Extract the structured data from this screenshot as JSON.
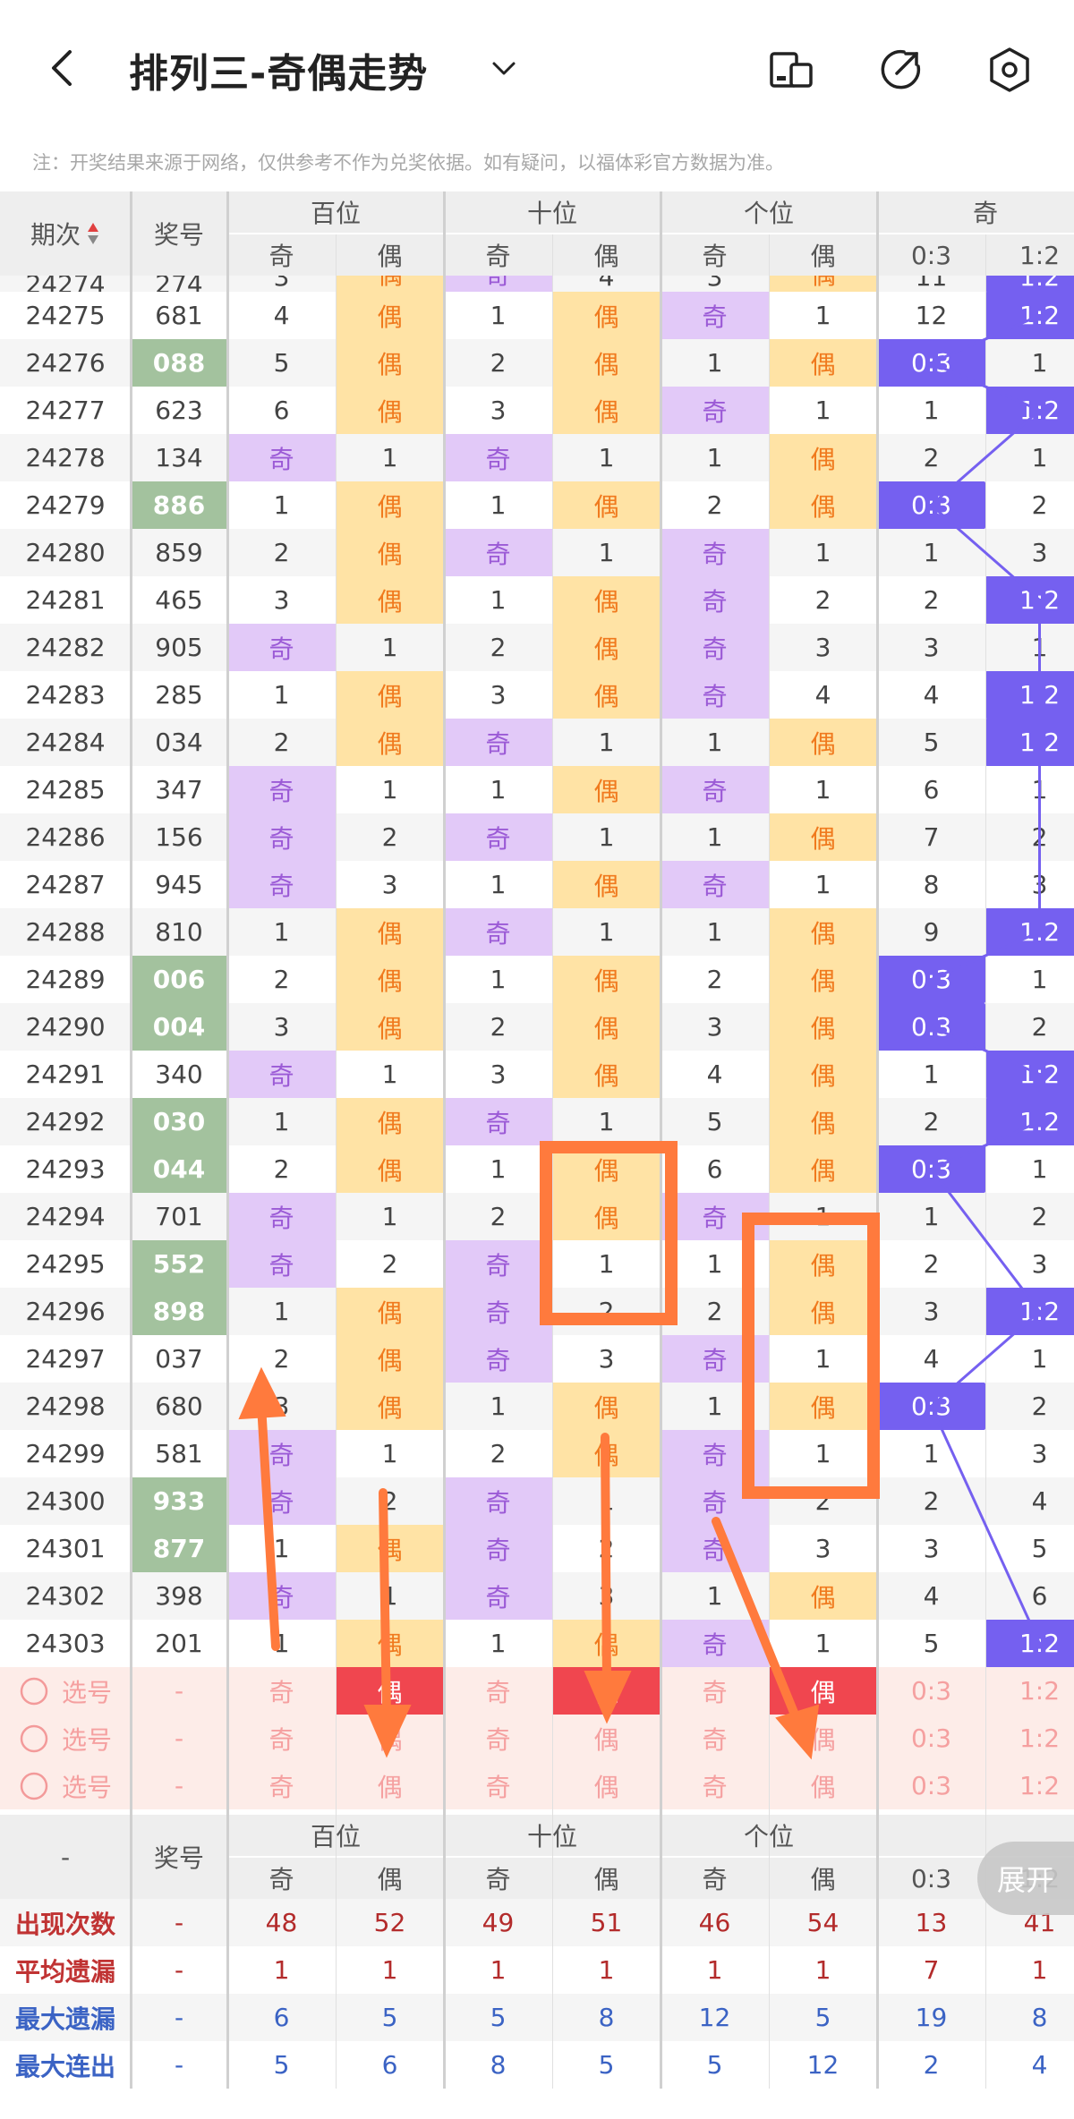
{
  "header": {
    "title": "排列三-奇偶走势",
    "notice": "注：开奖结果来源于网络，仅供参考不作为兑奖依据。如有疑问，以福体彩官方数据为准。"
  },
  "table": {
    "col_period": "期次",
    "col_number": "奖号",
    "groups": [
      "百位",
      "十位",
      "个位",
      "奇"
    ],
    "sub_odd": "奇",
    "sub_even": "偶",
    "ratio_cols": [
      "0:3",
      "1:2"
    ],
    "partial_row": {
      "period": "24274",
      "number": "274",
      "cells": [
        "3",
        "偶",
        "奇",
        "4",
        "3",
        "偶",
        "11",
        "1:2"
      ]
    },
    "rows": [
      {
        "period": "24275",
        "number": "681",
        "double": false,
        "cells": [
          "4",
          "偶",
          "1",
          "偶",
          "奇",
          "1",
          "12",
          "1:2"
        ]
      },
      {
        "period": "24276",
        "number": "088",
        "double": true,
        "cells": [
          "5",
          "偶",
          "2",
          "偶",
          "1",
          "偶",
          "0:3",
          "1"
        ]
      },
      {
        "period": "24277",
        "number": "623",
        "double": false,
        "cells": [
          "6",
          "偶",
          "3",
          "偶",
          "奇",
          "1",
          "1",
          "1:2"
        ]
      },
      {
        "period": "24278",
        "number": "134",
        "double": false,
        "cells": [
          "奇",
          "1",
          "奇",
          "1",
          "1",
          "偶",
          "2",
          "1"
        ]
      },
      {
        "period": "24279",
        "number": "886",
        "double": true,
        "cells": [
          "1",
          "偶",
          "1",
          "偶",
          "2",
          "偶",
          "0:3",
          "2"
        ]
      },
      {
        "period": "24280",
        "number": "859",
        "double": false,
        "cells": [
          "2",
          "偶",
          "奇",
          "1",
          "奇",
          "1",
          "1",
          "3"
        ]
      },
      {
        "period": "24281",
        "number": "465",
        "double": false,
        "cells": [
          "3",
          "偶",
          "1",
          "偶",
          "奇",
          "2",
          "2",
          "1:2"
        ]
      },
      {
        "period": "24282",
        "number": "905",
        "double": false,
        "cells": [
          "奇",
          "1",
          "2",
          "偶",
          "奇",
          "3",
          "3",
          "1"
        ]
      },
      {
        "period": "24283",
        "number": "285",
        "double": false,
        "cells": [
          "1",
          "偶",
          "3",
          "偶",
          "奇",
          "4",
          "4",
          "1:2"
        ]
      },
      {
        "period": "24284",
        "number": "034",
        "double": false,
        "cells": [
          "2",
          "偶",
          "奇",
          "1",
          "1",
          "偶",
          "5",
          "1:2"
        ]
      },
      {
        "period": "24285",
        "number": "347",
        "double": false,
        "cells": [
          "奇",
          "1",
          "1",
          "偶",
          "奇",
          "1",
          "6",
          "1"
        ]
      },
      {
        "period": "24286",
        "number": "156",
        "double": false,
        "cells": [
          "奇",
          "2",
          "奇",
          "1",
          "1",
          "偶",
          "7",
          "2"
        ]
      },
      {
        "period": "24287",
        "number": "945",
        "double": false,
        "cells": [
          "奇",
          "3",
          "1",
          "偶",
          "奇",
          "1",
          "8",
          "3"
        ]
      },
      {
        "period": "24288",
        "number": "810",
        "double": false,
        "cells": [
          "1",
          "偶",
          "奇",
          "1",
          "1",
          "偶",
          "9",
          "1:2"
        ]
      },
      {
        "period": "24289",
        "number": "006",
        "double": true,
        "cells": [
          "2",
          "偶",
          "1",
          "偶",
          "2",
          "偶",
          "0:3",
          "1"
        ]
      },
      {
        "period": "24290",
        "number": "004",
        "double": true,
        "cells": [
          "3",
          "偶",
          "2",
          "偶",
          "3",
          "偶",
          "0:3",
          "2"
        ]
      },
      {
        "period": "24291",
        "number": "340",
        "double": false,
        "cells": [
          "奇",
          "1",
          "3",
          "偶",
          "4",
          "偶",
          "1",
          "1:2"
        ]
      },
      {
        "period": "24292",
        "number": "030",
        "double": true,
        "cells": [
          "1",
          "偶",
          "奇",
          "1",
          "5",
          "偶",
          "2",
          "1:2"
        ]
      },
      {
        "period": "24293",
        "number": "044",
        "double": true,
        "cells": [
          "2",
          "偶",
          "1",
          "偶",
          "6",
          "偶",
          "0:3",
          "1"
        ]
      },
      {
        "period": "24294",
        "number": "701",
        "double": false,
        "cells": [
          "奇",
          "1",
          "2",
          "偶",
          "奇",
          "1",
          "1",
          "2"
        ]
      },
      {
        "period": "24295",
        "number": "552",
        "double": true,
        "cells": [
          "奇",
          "2",
          "奇",
          "1",
          "1",
          "偶",
          "2",
          "3"
        ]
      },
      {
        "period": "24296",
        "number": "898",
        "double": true,
        "cells": [
          "1",
          "偶",
          "奇",
          "2",
          "2",
          "偶",
          "3",
          "1:2"
        ]
      },
      {
        "period": "24297",
        "number": "037",
        "double": false,
        "cells": [
          "2",
          "偶",
          "奇",
          "3",
          "奇",
          "1",
          "4",
          "1"
        ]
      },
      {
        "period": "24298",
        "number": "680",
        "double": false,
        "cells": [
          "3",
          "偶",
          "1",
          "偶",
          "1",
          "偶",
          "0:3",
          "2"
        ]
      },
      {
        "period": "24299",
        "number": "581",
        "double": false,
        "cells": [
          "奇",
          "1",
          "2",
          "偶",
          "奇",
          "1",
          "1",
          "3"
        ]
      },
      {
        "period": "24300",
        "number": "933",
        "double": true,
        "cells": [
          "奇",
          "2",
          "奇",
          "1",
          "奇",
          "2",
          "2",
          "4"
        ]
      },
      {
        "period": "24301",
        "number": "877",
        "double": true,
        "cells": [
          "1",
          "偶",
          "奇",
          "2",
          "奇",
          "3",
          "3",
          "5"
        ]
      },
      {
        "period": "24302",
        "number": "398",
        "double": false,
        "cells": [
          "奇",
          "1",
          "奇",
          "3",
          "1",
          "偶",
          "4",
          "6"
        ]
      },
      {
        "period": "24303",
        "number": "201",
        "double": false,
        "cells": [
          "1",
          "偶",
          "1",
          "偶",
          "奇",
          "1",
          "5",
          "1:2"
        ]
      }
    ],
    "select_rows": [
      {
        "label": "选号",
        "number": "-",
        "cells": [
          "奇",
          "偶",
          "奇",
          "偶",
          "奇",
          "偶",
          "0:3",
          "1:2"
        ]
      },
      {
        "label": "选号",
        "number": "-",
        "cells": [
          "奇",
          "偶",
          "奇",
          "偶",
          "奇",
          "偶",
          "0:3",
          "1:2"
        ]
      },
      {
        "label": "选号",
        "number": "-",
        "cells": [
          "奇",
          "偶",
          "奇",
          "偶",
          "奇",
          "偶",
          "0:3",
          "1:2"
        ]
      }
    ],
    "footer": {
      "period_label": "-",
      "number_label": "奖号",
      "stats": [
        {
          "label": "出现次数",
          "dash": "-",
          "values": [
            "48",
            "52",
            "49",
            "51",
            "46",
            "54",
            "13",
            "41"
          ],
          "color": "red"
        },
        {
          "label": "平均遗漏",
          "dash": "-",
          "values": [
            "1",
            "1",
            "1",
            "1",
            "1",
            "1",
            "7",
            "1"
          ],
          "color": "red"
        },
        {
          "label": "最大遗漏",
          "dash": "-",
          "values": [
            "6",
            "5",
            "5",
            "8",
            "12",
            "5",
            "19",
            "8"
          ],
          "color": "blue"
        },
        {
          "label": "最大连出",
          "dash": "-",
          "values": [
            "5",
            "6",
            "8",
            "5",
            "5",
            "12",
            "2",
            "4"
          ],
          "color": "blue"
        }
      ]
    },
    "expand_label": "展开"
  },
  "colors": {
    "odd_bg": "#e2c9f8",
    "even_bg": "#ffe3a5",
    "ratio_bg": "#7560f0",
    "double_bg": "#a3c29e",
    "selected_bg": "#f0464f",
    "annotation": "#ff7a3d"
  },
  "icons": [
    "back-icon",
    "chevron-down-icon",
    "compare-icon",
    "share-icon",
    "settings-icon",
    "sort-icon"
  ]
}
